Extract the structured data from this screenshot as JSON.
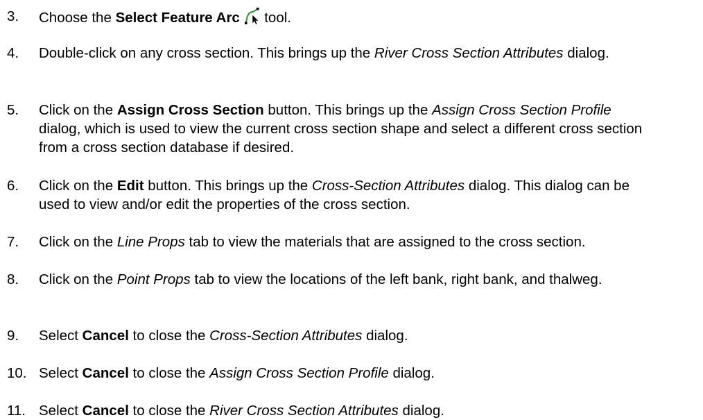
{
  "steps": [
    {
      "number": "3.",
      "parts": [
        {
          "t": "Choose the "
        },
        {
          "t": "Select Feature Arc",
          "s": "b"
        },
        {
          "t": " "
        },
        {
          "icon": "select-feature-arc-icon"
        },
        {
          "t": " tool."
        }
      ]
    },
    {
      "number": "4.",
      "parts": [
        {
          "t": "Double-click on any cross section. This brings up the "
        },
        {
          "t": "River Cross Section Attributes",
          "s": "i"
        },
        {
          "t": " dialog."
        }
      ]
    },
    {
      "number": "5.",
      "parts": [
        {
          "t": "Click on the "
        },
        {
          "t": "Assign Cross Section",
          "s": "b"
        },
        {
          "t": " button. This brings up the "
        },
        {
          "t": "Assign Cross Section Profile",
          "s": "i"
        },
        {
          "t": " dialog, which is used to view the current cross section shape and select a different cross section from a cross section database if desired."
        }
      ]
    },
    {
      "number": "6.",
      "parts": [
        {
          "t": "Click on the "
        },
        {
          "t": "Edit",
          "s": "b"
        },
        {
          "t": " button. This brings up the "
        },
        {
          "t": "Cross-Section Attributes",
          "s": "i"
        },
        {
          "t": " dialog. This dialog can be used to view and/or edit the properties of the cross section."
        }
      ]
    },
    {
      "number": "7.",
      "parts": [
        {
          "t": "Click on the "
        },
        {
          "t": "Line Props",
          "s": "i"
        },
        {
          "t": " tab to view the materials that are assigned to the cross section."
        }
      ]
    },
    {
      "number": "8.",
      "parts": [
        {
          "t": "Click on the "
        },
        {
          "t": "Point Props",
          "s": "i"
        },
        {
          "t": " tab to view the locations of the left bank, right bank, and thalweg."
        }
      ]
    },
    {
      "number": "9.",
      "parts": [
        {
          "t": "Select "
        },
        {
          "t": "Cancel",
          "s": "b"
        },
        {
          "t": " to close the "
        },
        {
          "t": "Cross-Section Attributes",
          "s": "i"
        },
        {
          "t": " dialog."
        }
      ]
    },
    {
      "number": "10.",
      "parts": [
        {
          "t": "Select "
        },
        {
          "t": "Cancel",
          "s": "b"
        },
        {
          "t": " to close the "
        },
        {
          "t": "Assign Cross Section Profile",
          "s": "i"
        },
        {
          "t": " dialog."
        }
      ]
    },
    {
      "number": "11.",
      "parts": [
        {
          "t": "Select "
        },
        {
          "t": "Cancel",
          "s": "b"
        },
        {
          "t": " to close the "
        },
        {
          "t": "River Cross Section Attributes",
          "s": "i"
        },
        {
          "t": " dialog."
        }
      ]
    }
  ],
  "colors": {
    "text": "#000000",
    "icon_curve": "#3a9a3a",
    "icon_cursor": "#000000"
  }
}
